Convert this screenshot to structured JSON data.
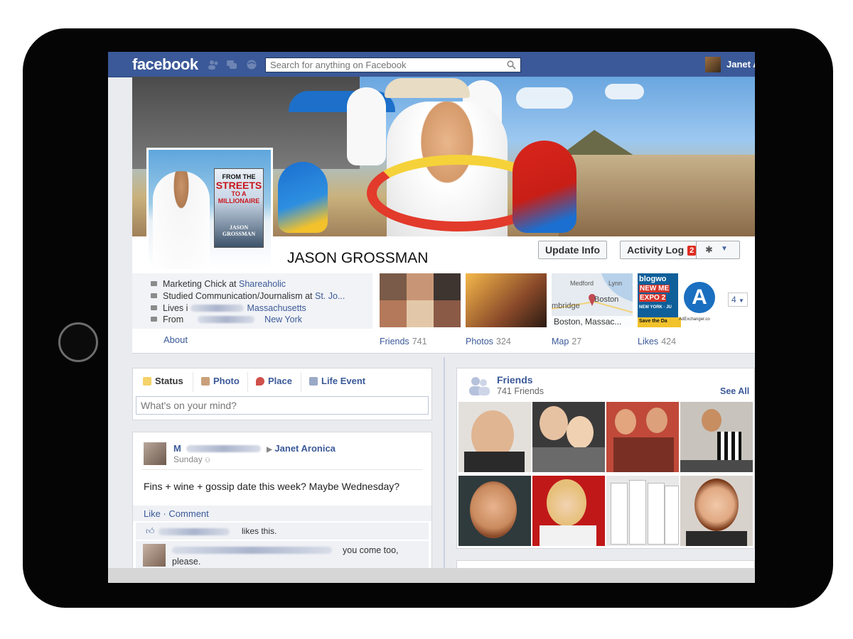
{
  "topbar": {
    "logo": "facebook",
    "search_placeholder": "Search for anything on Facebook",
    "user_name": "Janet A"
  },
  "profile": {
    "name": "JASON GROSSMAN",
    "book": {
      "title_line1": "FROM THE",
      "title_line2": "STREETS",
      "title_line3": "TO A",
      "title_line4": "MILLIONAIRE",
      "author_line1": "JASON",
      "author_line2": "GROSSMAN"
    },
    "update_info_label": "Update Info",
    "activity_log_label": "Activity Log",
    "activity_log_count": "2"
  },
  "info": {
    "work_prefix": "Marketing Chick at ",
    "work_link": "Shareaholic",
    "study_prefix": "Studied Communication/Journalism at ",
    "study_link": "St. Jo...",
    "lives_prefix": "Lives i",
    "lives_link": "Massachusetts",
    "from_prefix": "From",
    "from_link": "New York",
    "about_label": "About"
  },
  "apps": [
    {
      "label": "Friends",
      "count": "741"
    },
    {
      "label": "Photos",
      "count": "324"
    },
    {
      "label": "Map",
      "count": "27"
    },
    {
      "label": "Likes",
      "count": "424"
    }
  ],
  "apps_more": "4",
  "map_tile": {
    "city1": "Medford",
    "city2": "Lynn",
    "city3": "mbridge",
    "city4": "Boston",
    "caption": "Boston, Massac..."
  },
  "likes_tile": {
    "name1": "blogwo",
    "name2": "NEW ME",
    "name3": "EXPO 2",
    "name4": "NEW YORK · JU",
    "name5": "Save the Da",
    "name6": "AdExchanger.co"
  },
  "composer": {
    "tabs": [
      "Status",
      "Photo",
      "Place",
      "Life Event"
    ],
    "placeholder": "What's on your mind?"
  },
  "post": {
    "author_first": "M",
    "recipient": "Janet Aronica",
    "time": "Sunday",
    "text": "Fins + wine + gossip date this week? Maybe Wednesday?",
    "like_label": "Like",
    "comment_label": "Comment",
    "separator": " · ",
    "likes_text": "likes this.",
    "comment_text": "you come too, please."
  },
  "friends_box": {
    "title": "Friends",
    "count": "741 Friends",
    "see_all": "See All"
  },
  "colors": {
    "facebook_blue": "#3b5998",
    "link_blue": "#3b5998",
    "badge_red": "#e02c22",
    "page_bg": "#e9ebee"
  }
}
